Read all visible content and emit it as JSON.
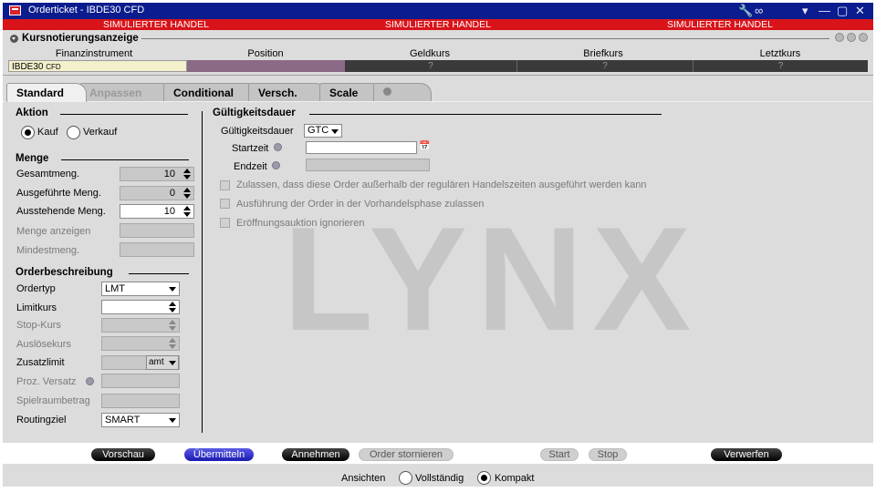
{
  "window": {
    "title": "Orderticket - IBDE30 CFD",
    "sim_label_1": "SIMULIERTER HANDEL",
    "sim_label_2": "SIMULIERTER HANDEL",
    "sim_label_3": "SIMULIERTER HANDEL"
  },
  "quote_panel": {
    "title": "Kursnotierungsanzeige",
    "columns": [
      "Finanzinstrument",
      "Position",
      "Geldkurs",
      "Briefkurs",
      "Letztkurs"
    ],
    "instrument": "IBDE30",
    "instrument_type": "CFD",
    "position": "",
    "bid": "?",
    "ask": "?",
    "last": "?"
  },
  "tabs": [
    {
      "label": "Standard"
    },
    {
      "label": "Anpassen"
    },
    {
      "label": "Conditional"
    },
    {
      "label": "Versch."
    },
    {
      "label": "Scale"
    }
  ],
  "action": {
    "title": "Aktion",
    "buy_label": "Kauf",
    "sell_label": "Verkauf",
    "selected": "Kauf"
  },
  "quantity": {
    "title": "Menge",
    "total_label": "Gesamtmeng.",
    "total_value": "10",
    "filled_label": "Ausgeführte Meng.",
    "filled_value": "0",
    "remaining_label": "Ausstehende Meng.",
    "remaining_value": "10",
    "display_label": "Menge anzeigen",
    "min_label": "Mindestmeng."
  },
  "order_desc": {
    "title": "Orderbeschreibung",
    "order_type_label": "Ordertyp",
    "order_type_value": "LMT",
    "limit_label": "Limitkurs",
    "stop_label": "Stop-Kurs",
    "trigger_label": "Auslösekurs",
    "extra_limit_label": "Zusatzlimit",
    "extra_limit_unit": "amt",
    "pct_offset_label": "Proz. Versatz",
    "range_label": "Spielraumbetrag",
    "routing_label": "Routingziel",
    "routing_value": "SMART"
  },
  "validity": {
    "title": "Gültigkeitsdauer",
    "tif_label": "Gültigkeitsdauer",
    "tif_value": "GTC",
    "start_label": "Startzeit",
    "end_label": "Endzeit",
    "opt_outside_rth": "Zulassen, dass diese Order außerhalb der regulären Handelszeiten ausgeführt werden kann",
    "opt_premarket": "Ausführung der Order in der Vorhandelsphase zulassen",
    "opt_opening": "Eröffnungsauktion ignorieren"
  },
  "watermark": "LYNX",
  "buttons": {
    "preview": "Vorschau",
    "transmit": "Übermitteln",
    "accept": "Annehmen",
    "cancel_order": "Order stornieren",
    "start": "Start",
    "stop": "Stop",
    "discard": "Verwerfen"
  },
  "views": {
    "label": "Ansichten",
    "full": "Vollständig",
    "compact": "Kompakt",
    "selected": "Kompakt"
  },
  "colors": {
    "titlebar": "#0a1c8e",
    "sim_band": "#d8141a",
    "transmit_button": "#2a2ad0"
  }
}
